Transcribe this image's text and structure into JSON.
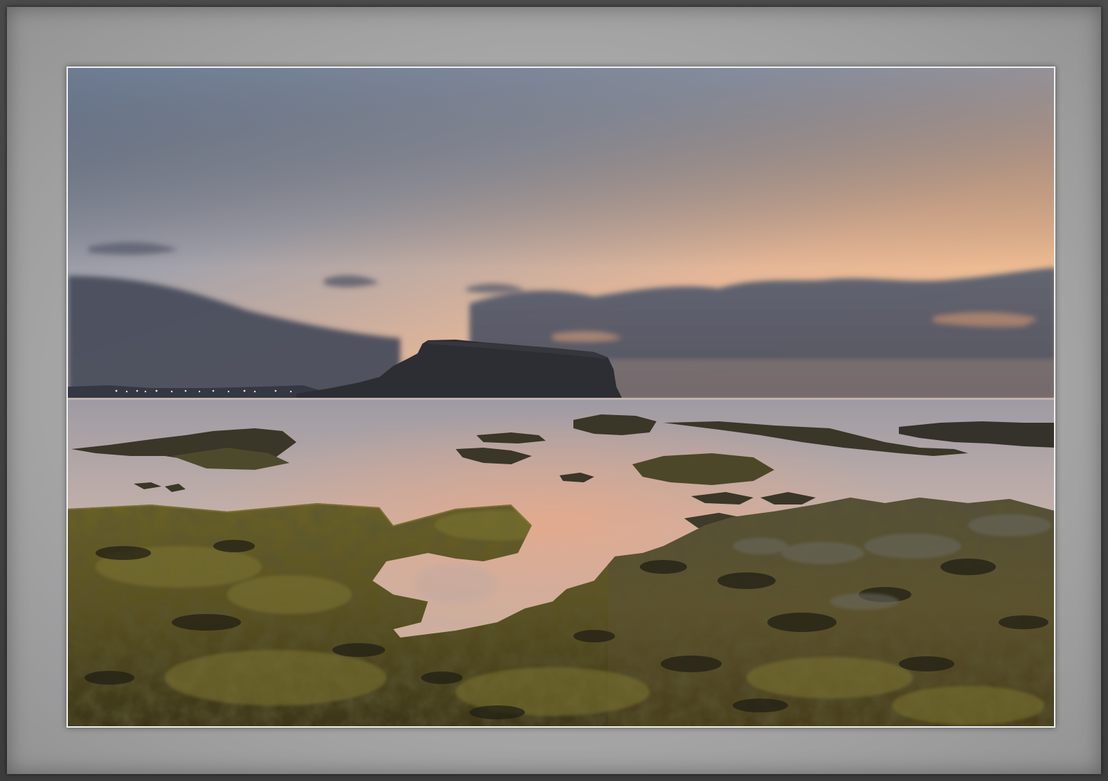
{
  "image": {
    "subject": "coastal-sunset",
    "elements": [
      "sky",
      "clouds",
      "tuff-cone-headland",
      "town-lights",
      "sea",
      "tide-pools",
      "mossy-volcanic-rocks"
    ],
    "colors": {
      "sky_top": "#7f8ea3",
      "sky_glow": "#f6c08e",
      "horizon_peach": "#f2b889",
      "cloud_dark": "#4f5566",
      "headland": "#2e3036",
      "water": "#c7b6ae",
      "rock_moss": "#6f6425",
      "rock_dark": "#2b2a22"
    }
  }
}
